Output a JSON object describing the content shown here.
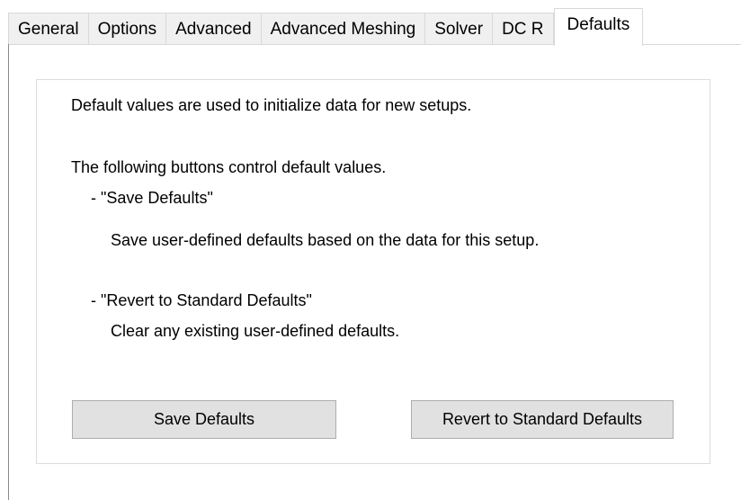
{
  "tabs": [
    {
      "label": "General"
    },
    {
      "label": "Options"
    },
    {
      "label": "Advanced"
    },
    {
      "label": "Advanced Meshing"
    },
    {
      "label": "Solver"
    },
    {
      "label": "DC R"
    },
    {
      "label": "Defaults",
      "selected": true
    }
  ],
  "content": {
    "intro": "Default values are used to initialize data for new setups.",
    "following": "The following buttons control default values.",
    "save_heading": "- \"Save Defaults\"",
    "save_desc": "Save user-defined defaults based on the data for this setup.",
    "revert_heading": "- \"Revert to Standard Defaults\"",
    "revert_desc": "Clear any existing user-defined defaults."
  },
  "buttons": {
    "save": "Save Defaults",
    "revert": "Revert to Standard Defaults"
  },
  "colors": {
    "button_bg": "#e1e1e1",
    "button_border": "#adadad",
    "tab_bg": "#f0f0f0",
    "selected_tab_bg": "#ffffff"
  }
}
